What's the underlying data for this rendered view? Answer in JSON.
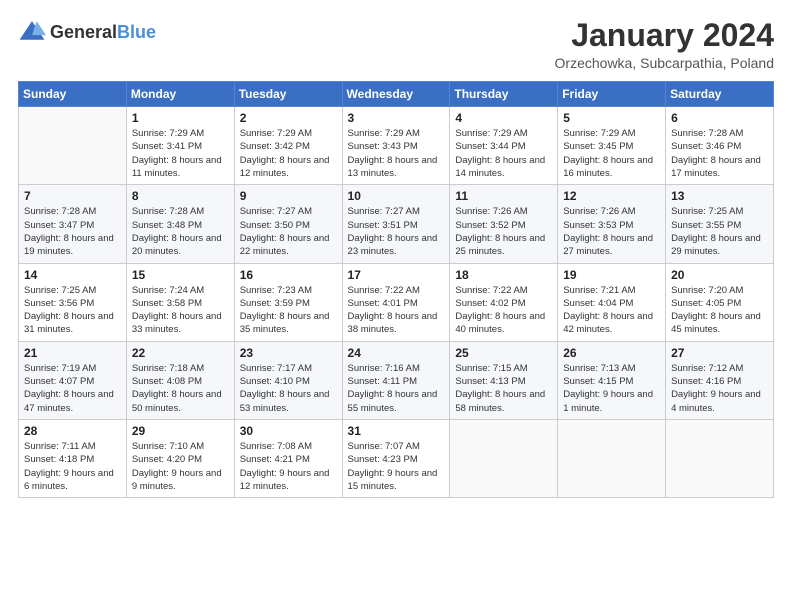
{
  "logo": {
    "text_general": "General",
    "text_blue": "Blue"
  },
  "header": {
    "month_year": "January 2024",
    "location": "Orzechowka, Subcarpathia, Poland"
  },
  "weekdays": [
    "Sunday",
    "Monday",
    "Tuesday",
    "Wednesday",
    "Thursday",
    "Friday",
    "Saturday"
  ],
  "weeks": [
    [
      {
        "day": "",
        "sunrise": "",
        "sunset": "",
        "daylight": ""
      },
      {
        "day": "1",
        "sunrise": "Sunrise: 7:29 AM",
        "sunset": "Sunset: 3:41 PM",
        "daylight": "Daylight: 8 hours and 11 minutes."
      },
      {
        "day": "2",
        "sunrise": "Sunrise: 7:29 AM",
        "sunset": "Sunset: 3:42 PM",
        "daylight": "Daylight: 8 hours and 12 minutes."
      },
      {
        "day": "3",
        "sunrise": "Sunrise: 7:29 AM",
        "sunset": "Sunset: 3:43 PM",
        "daylight": "Daylight: 8 hours and 13 minutes."
      },
      {
        "day": "4",
        "sunrise": "Sunrise: 7:29 AM",
        "sunset": "Sunset: 3:44 PM",
        "daylight": "Daylight: 8 hours and 14 minutes."
      },
      {
        "day": "5",
        "sunrise": "Sunrise: 7:29 AM",
        "sunset": "Sunset: 3:45 PM",
        "daylight": "Daylight: 8 hours and 16 minutes."
      },
      {
        "day": "6",
        "sunrise": "Sunrise: 7:28 AM",
        "sunset": "Sunset: 3:46 PM",
        "daylight": "Daylight: 8 hours and 17 minutes."
      }
    ],
    [
      {
        "day": "7",
        "sunrise": "Sunrise: 7:28 AM",
        "sunset": "Sunset: 3:47 PM",
        "daylight": "Daylight: 8 hours and 19 minutes."
      },
      {
        "day": "8",
        "sunrise": "Sunrise: 7:28 AM",
        "sunset": "Sunset: 3:48 PM",
        "daylight": "Daylight: 8 hours and 20 minutes."
      },
      {
        "day": "9",
        "sunrise": "Sunrise: 7:27 AM",
        "sunset": "Sunset: 3:50 PM",
        "daylight": "Daylight: 8 hours and 22 minutes."
      },
      {
        "day": "10",
        "sunrise": "Sunrise: 7:27 AM",
        "sunset": "Sunset: 3:51 PM",
        "daylight": "Daylight: 8 hours and 23 minutes."
      },
      {
        "day": "11",
        "sunrise": "Sunrise: 7:26 AM",
        "sunset": "Sunset: 3:52 PM",
        "daylight": "Daylight: 8 hours and 25 minutes."
      },
      {
        "day": "12",
        "sunrise": "Sunrise: 7:26 AM",
        "sunset": "Sunset: 3:53 PM",
        "daylight": "Daylight: 8 hours and 27 minutes."
      },
      {
        "day": "13",
        "sunrise": "Sunrise: 7:25 AM",
        "sunset": "Sunset: 3:55 PM",
        "daylight": "Daylight: 8 hours and 29 minutes."
      }
    ],
    [
      {
        "day": "14",
        "sunrise": "Sunrise: 7:25 AM",
        "sunset": "Sunset: 3:56 PM",
        "daylight": "Daylight: 8 hours and 31 minutes."
      },
      {
        "day": "15",
        "sunrise": "Sunrise: 7:24 AM",
        "sunset": "Sunset: 3:58 PM",
        "daylight": "Daylight: 8 hours and 33 minutes."
      },
      {
        "day": "16",
        "sunrise": "Sunrise: 7:23 AM",
        "sunset": "Sunset: 3:59 PM",
        "daylight": "Daylight: 8 hours and 35 minutes."
      },
      {
        "day": "17",
        "sunrise": "Sunrise: 7:22 AM",
        "sunset": "Sunset: 4:01 PM",
        "daylight": "Daylight: 8 hours and 38 minutes."
      },
      {
        "day": "18",
        "sunrise": "Sunrise: 7:22 AM",
        "sunset": "Sunset: 4:02 PM",
        "daylight": "Daylight: 8 hours and 40 minutes."
      },
      {
        "day": "19",
        "sunrise": "Sunrise: 7:21 AM",
        "sunset": "Sunset: 4:04 PM",
        "daylight": "Daylight: 8 hours and 42 minutes."
      },
      {
        "day": "20",
        "sunrise": "Sunrise: 7:20 AM",
        "sunset": "Sunset: 4:05 PM",
        "daylight": "Daylight: 8 hours and 45 minutes."
      }
    ],
    [
      {
        "day": "21",
        "sunrise": "Sunrise: 7:19 AM",
        "sunset": "Sunset: 4:07 PM",
        "daylight": "Daylight: 8 hours and 47 minutes."
      },
      {
        "day": "22",
        "sunrise": "Sunrise: 7:18 AM",
        "sunset": "Sunset: 4:08 PM",
        "daylight": "Daylight: 8 hours and 50 minutes."
      },
      {
        "day": "23",
        "sunrise": "Sunrise: 7:17 AM",
        "sunset": "Sunset: 4:10 PM",
        "daylight": "Daylight: 8 hours and 53 minutes."
      },
      {
        "day": "24",
        "sunrise": "Sunrise: 7:16 AM",
        "sunset": "Sunset: 4:11 PM",
        "daylight": "Daylight: 8 hours and 55 minutes."
      },
      {
        "day": "25",
        "sunrise": "Sunrise: 7:15 AM",
        "sunset": "Sunset: 4:13 PM",
        "daylight": "Daylight: 8 hours and 58 minutes."
      },
      {
        "day": "26",
        "sunrise": "Sunrise: 7:13 AM",
        "sunset": "Sunset: 4:15 PM",
        "daylight": "Daylight: 9 hours and 1 minute."
      },
      {
        "day": "27",
        "sunrise": "Sunrise: 7:12 AM",
        "sunset": "Sunset: 4:16 PM",
        "daylight": "Daylight: 9 hours and 4 minutes."
      }
    ],
    [
      {
        "day": "28",
        "sunrise": "Sunrise: 7:11 AM",
        "sunset": "Sunset: 4:18 PM",
        "daylight": "Daylight: 9 hours and 6 minutes."
      },
      {
        "day": "29",
        "sunrise": "Sunrise: 7:10 AM",
        "sunset": "Sunset: 4:20 PM",
        "daylight": "Daylight: 9 hours and 9 minutes."
      },
      {
        "day": "30",
        "sunrise": "Sunrise: 7:08 AM",
        "sunset": "Sunset: 4:21 PM",
        "daylight": "Daylight: 9 hours and 12 minutes."
      },
      {
        "day": "31",
        "sunrise": "Sunrise: 7:07 AM",
        "sunset": "Sunset: 4:23 PM",
        "daylight": "Daylight: 9 hours and 15 minutes."
      },
      {
        "day": "",
        "sunrise": "",
        "sunset": "",
        "daylight": ""
      },
      {
        "day": "",
        "sunrise": "",
        "sunset": "",
        "daylight": ""
      },
      {
        "day": "",
        "sunrise": "",
        "sunset": "",
        "daylight": ""
      }
    ]
  ]
}
